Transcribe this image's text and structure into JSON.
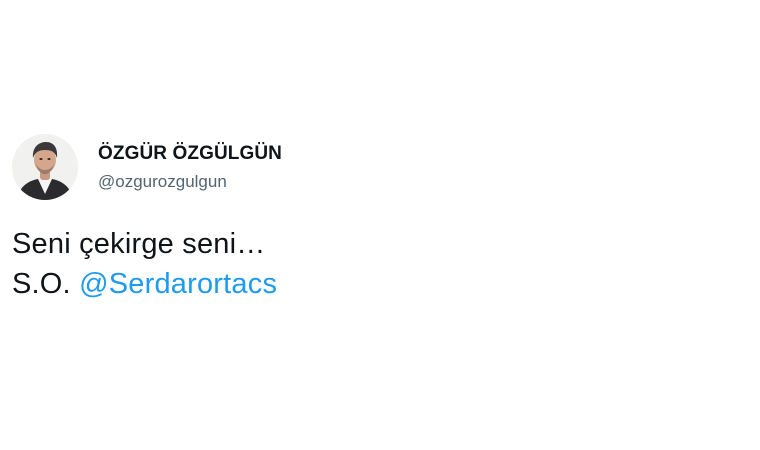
{
  "tweet": {
    "author": {
      "display_name": "ÖZGÜR ÖZGÜLGÜN",
      "handle": "@ozgurozgulgun",
      "avatar": "profile-photo"
    },
    "text_line1": "Seni çekirge seni…",
    "text_line2_prefix": "S.O.",
    "mention": "@Serdarortacs"
  },
  "colors": {
    "text": "#0f1419",
    "secondary_text": "#536471",
    "link": "#1d9bf0",
    "background": "#ffffff"
  }
}
